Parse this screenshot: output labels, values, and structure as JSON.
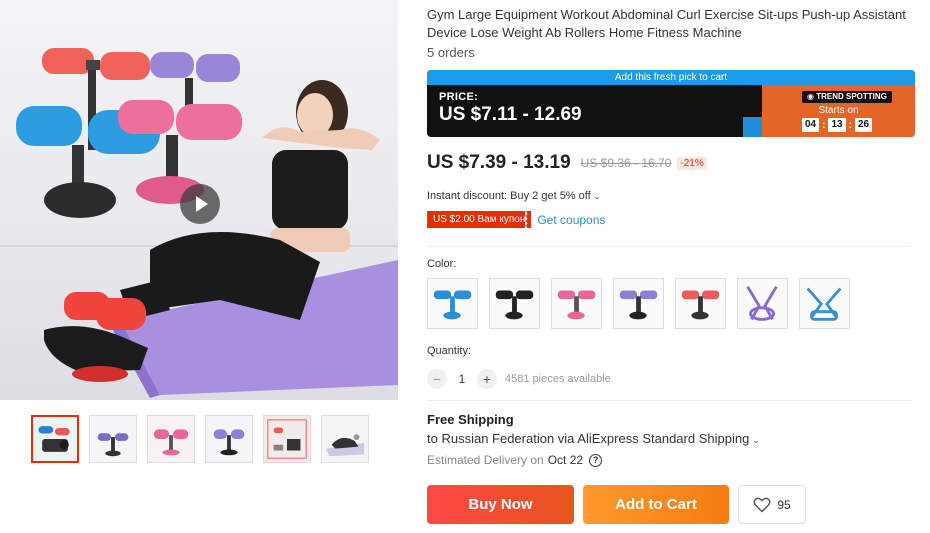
{
  "gallery": {
    "main_image_alt": "Woman using sit-up assistant on purple mat",
    "thumbnails": [
      {
        "color": "#2a7fd0",
        "active": true
      },
      {
        "color": "#7b6ccc",
        "active": false
      },
      {
        "color": "#e8669a",
        "active": false
      },
      {
        "color": "#8f7fd6",
        "active": false
      },
      {
        "color": "#ee5a5a",
        "active": false
      },
      {
        "color": "#9a9a9a",
        "active": false
      }
    ]
  },
  "product": {
    "title": "Gym Large Equipment Workout Abdominal Curl Exercise Sit-ups Push-up Assistant Device Lose Weight Ab Rollers Home Fitness Machine",
    "orders": "5 orders"
  },
  "promo": {
    "banner": "Add this fresh pick to cart",
    "price_label": "PRICE:",
    "price_range": "US $7.11 - 12.69",
    "trend_badge": "TREND SPOTTING",
    "starts_on": "Starts on",
    "timer": {
      "h": "04",
      "m": "13",
      "s": "26"
    }
  },
  "pricing": {
    "current": "US $7.39 - 13.19",
    "original": "US $9.36 - 16.70",
    "discount": "-21%",
    "instant_discount": "Instant discount: Buy 2 get 5% off",
    "coupon": "US $2.00 Вам купон",
    "get_coupons": "Get coupons"
  },
  "color": {
    "label": "Color:",
    "options": [
      {
        "name": "blue",
        "color": "#2a8fd8"
      },
      {
        "name": "black",
        "color": "#222222"
      },
      {
        "name": "pink",
        "color": "#e8669a"
      },
      {
        "name": "purple",
        "color": "#8f7fd6"
      },
      {
        "name": "red",
        "color": "#ee5a5a"
      },
      {
        "name": "purple-band",
        "color": "#8a6ad0"
      },
      {
        "name": "blue-band",
        "color": "#3a8fcf"
      }
    ]
  },
  "quantity": {
    "label": "Quantity:",
    "value": "1",
    "minus": "−",
    "plus": "+",
    "available": "4581 pieces available"
  },
  "shipping": {
    "title": "Free Shipping",
    "to": "to Russian Federation via AliExpress Standard Shipping",
    "eta_label": "Estimated Delivery on",
    "eta_date": "Oct 22",
    "help": "?"
  },
  "actions": {
    "buy_now": "Buy Now",
    "add_to_cart": "Add to Cart",
    "wishlist_count": "95"
  },
  "colors": {
    "accent": "#e62e04",
    "buy_now": "#ff4747",
    "add_to_cart": "#f57b12",
    "promo_blue": "#1e9be8",
    "promo_orange": "#e2662a",
    "link": "#2e8bd6"
  },
  "icons": {
    "play": "play-icon",
    "heart": "heart-icon",
    "chevron": "chevron-down-icon",
    "help": "question-circle-icon"
  }
}
